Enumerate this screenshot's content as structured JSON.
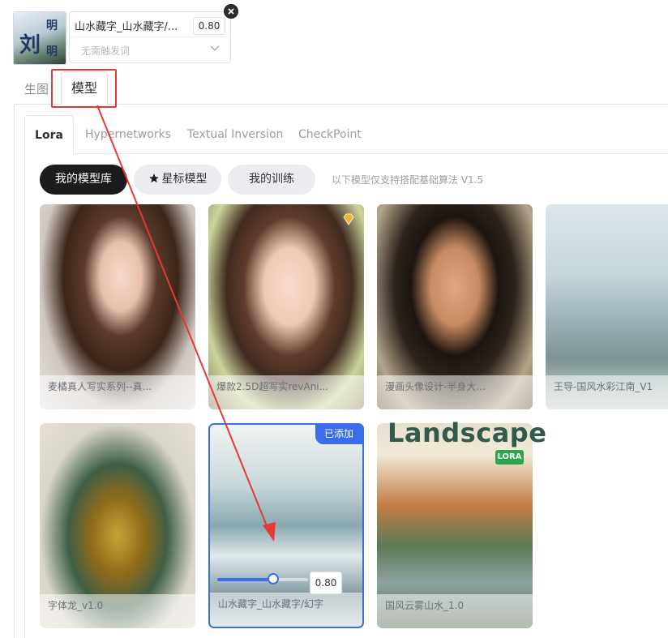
{
  "selected_lora": {
    "name": "山水藏字_山水藏字/...",
    "weight": "0.80",
    "trigger_placeholder": "无需触发词",
    "thumb_chars": [
      "刘",
      "明",
      "明"
    ]
  },
  "tabs": [
    {
      "label": "生图"
    },
    {
      "label": "模型"
    }
  ],
  "sub_tabs": [
    {
      "label": "Lora"
    },
    {
      "label": "Hypernetworks"
    },
    {
      "label": "Textual Inversion"
    },
    {
      "label": "CheckPoint"
    }
  ],
  "filters": {
    "my_library": "我的模型库",
    "starred": "星标模型",
    "my_training": "我的训练",
    "note": "以下模型仅支持搭配基础算法 V1.5"
  },
  "models": [
    {
      "caption": "麦橘真人写实系列--真..."
    },
    {
      "caption": "爆款2.5D超写实revAni..."
    },
    {
      "caption": "漫画头像设计-半身大..."
    },
    {
      "caption": "王导-国风水彩江南_V1"
    },
    {
      "caption": "字体龙_v1.0"
    },
    {
      "caption": "山水藏字_山水藏字/幻字",
      "badge": "已添加",
      "weight": "0.80",
      "weight_fraction": 0.62
    },
    {
      "caption": "国风云雾山水_1.0",
      "title": "Landscape",
      "tag": "LORA"
    }
  ],
  "colors": {
    "accent": "#3a6ee8",
    "dark": "#1c1c1e",
    "annotation": "#e53935"
  }
}
